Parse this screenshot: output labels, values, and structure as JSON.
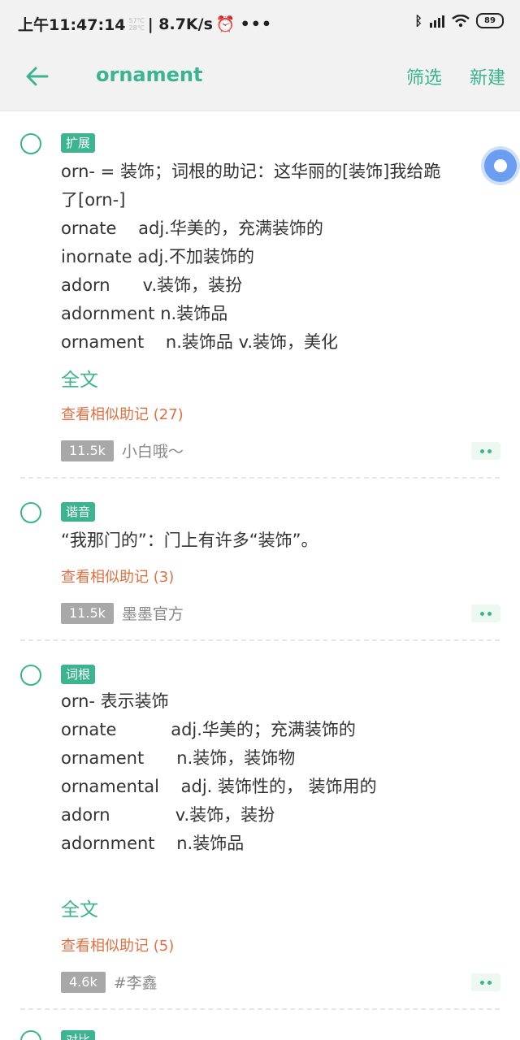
{
  "statusbar": {
    "time": "上午11:47:14",
    "temp_top": "57℃",
    "temp_bottom": "28℃",
    "speed": "| 8.7K/s",
    "battery": "89"
  },
  "appbar": {
    "title": "ornament",
    "filter_label": "筛选",
    "new_label": "新建"
  },
  "cards": [
    {
      "tag": "扩展",
      "lines": [
        "orn- = 装饰；词根的助记：这华丽的[装饰]我给跪",
        "了[orn-]",
        "ornate    adj.华美的，充满装饰的",
        "inornate adj.不加装饰的",
        "adorn      v.装饰，装扮",
        "adornment n.装饰品",
        "ornament    n.装饰品 v.装饰，美化"
      ],
      "fulltext": "全文",
      "similar": "查看相似助记 (27)",
      "count": "11.5k",
      "author": "小白哦～"
    },
    {
      "tag": "谐音",
      "lines": [
        "“我那门的”：门上有许多“装饰”。"
      ],
      "similar": "查看相似助记 (3)",
      "count": "11.5k",
      "author": "墨墨官方"
    },
    {
      "tag": "词根",
      "lines": [
        "orn- 表示装饰",
        "ornate          adj.华美的；充满装饰的",
        "ornament      n.装饰，装饰物",
        "ornamental    adj. 装饰性的， 装饰用的",
        "adorn            v.装饰，装扮",
        "adornment    n.装饰品"
      ],
      "fulltext": "全文",
      "similar": "查看相似助记 (5)",
      "count": "4.6k",
      "author": "#李鑫"
    },
    {
      "tag": "对比"
    }
  ],
  "colors": {
    "accent": "#3cb48f",
    "link_orange": "#e07040",
    "count_bg": "#a8a8a8"
  }
}
